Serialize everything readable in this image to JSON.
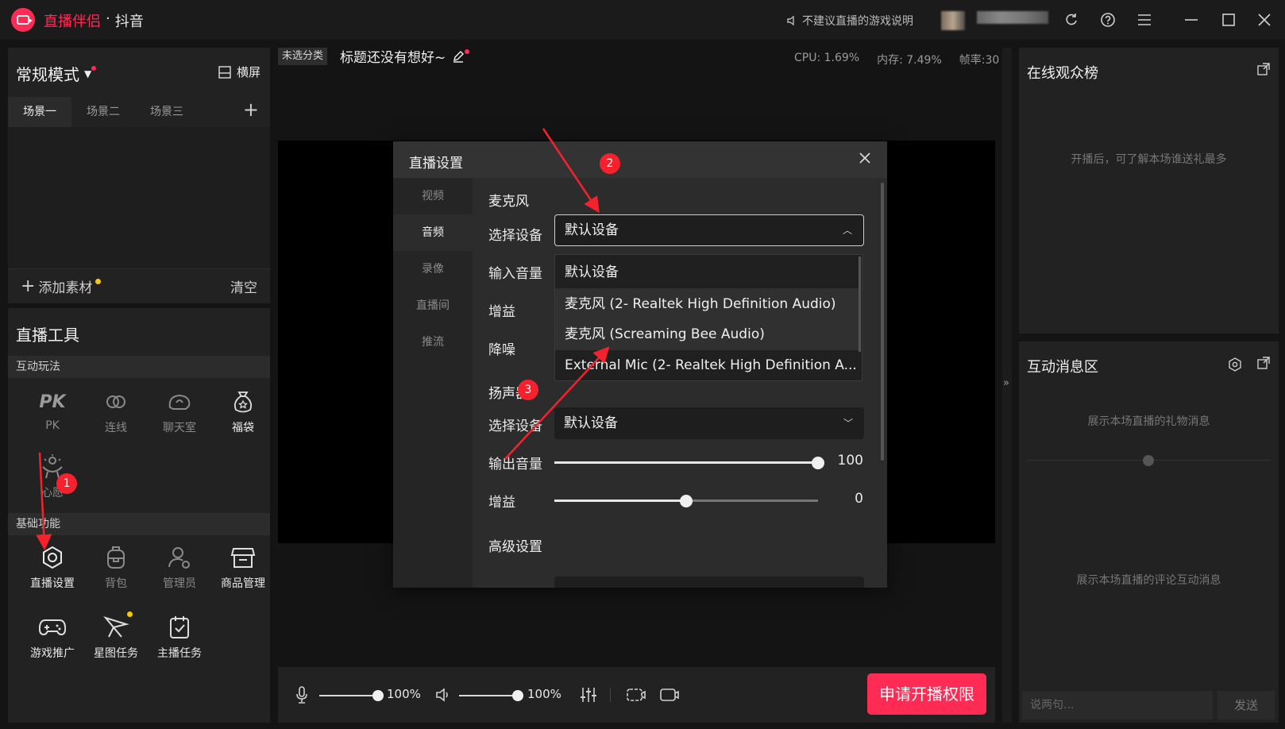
{
  "app": {
    "name": "直播伴侣",
    "separator": "·",
    "platform": "抖音",
    "notice": "不建议直播的游戏说明",
    "brand_color": "#fe2c55"
  },
  "left": {
    "mode_label": "常规模式",
    "landscape_label": "横屏",
    "scene_tabs": [
      "场景一",
      "场景二",
      "场景三"
    ],
    "add_material": "添加素材",
    "clear": "清空",
    "tools_title": "直播工具",
    "section_interactive": "互动玩法",
    "section_basic": "基础功能",
    "interactive": [
      {
        "label": "PK",
        "icon": "pk-icon"
      },
      {
        "label": "连线",
        "icon": "link-icon"
      },
      {
        "label": "聊天室",
        "icon": "chatroom-icon"
      },
      {
        "label": "福袋",
        "icon": "lucky-bag-icon"
      },
      {
        "label": "心愿",
        "icon": "wish-icon"
      }
    ],
    "basic": [
      {
        "label": "直播设置",
        "icon": "settings-icon"
      },
      {
        "label": "背包",
        "icon": "backpack-icon"
      },
      {
        "label": "管理员",
        "icon": "admin-icon"
      },
      {
        "label": "商品管理",
        "icon": "shop-icon"
      },
      {
        "label": "游戏推广",
        "icon": "gamepad-icon"
      },
      {
        "label": "星图任务",
        "icon": "star-task-icon"
      },
      {
        "label": "主播任务",
        "icon": "task-icon"
      }
    ]
  },
  "center": {
    "category_tag": "未选分类",
    "stream_title": "标题还没有想好~",
    "cpu": "CPU: 1.69%",
    "memory": "内存: 7.49%",
    "fps": "帧率:30",
    "mic_volume": "100%",
    "speaker_volume": "100%",
    "go_live": "申请开播权限"
  },
  "right": {
    "audience_title": "在线观众榜",
    "audience_hint": "开播后，可了解本场谁送礼最多",
    "messages_title": "互动消息区",
    "gift_hint": "展示本场直播的礼物消息",
    "comment_hint": "展示本场直播的评论互动消息",
    "chat_placeholder": "说两句...",
    "send": "发送"
  },
  "dialog": {
    "title": "直播设置",
    "nav": [
      "视频",
      "音频",
      "录像",
      "直播间",
      "推流"
    ],
    "active_nav": "音频",
    "mic_section": "麦克风",
    "select_device": "选择设备",
    "input_volume": "输入音量",
    "gain": "增益",
    "noise_reduction": "降噪",
    "mic_selected": "默认设备",
    "mic_options": [
      "默认设备",
      "麦克风 (2- Realtek High Definition Audio)",
      "麦克风 (Screaming Bee Audio)",
      "External Mic (2- Realtek High Definition A..."
    ],
    "speaker_section": "扬声器",
    "speaker_selected": "默认设备",
    "output_volume": "输出音量",
    "output_volume_value": "100",
    "output_volume_level": 1.0,
    "speaker_gain": "增益",
    "speaker_gain_value": "0",
    "speaker_gain_level": 0.5,
    "advanced": "高级设置"
  },
  "annotations": [
    "1",
    "2",
    "3"
  ]
}
